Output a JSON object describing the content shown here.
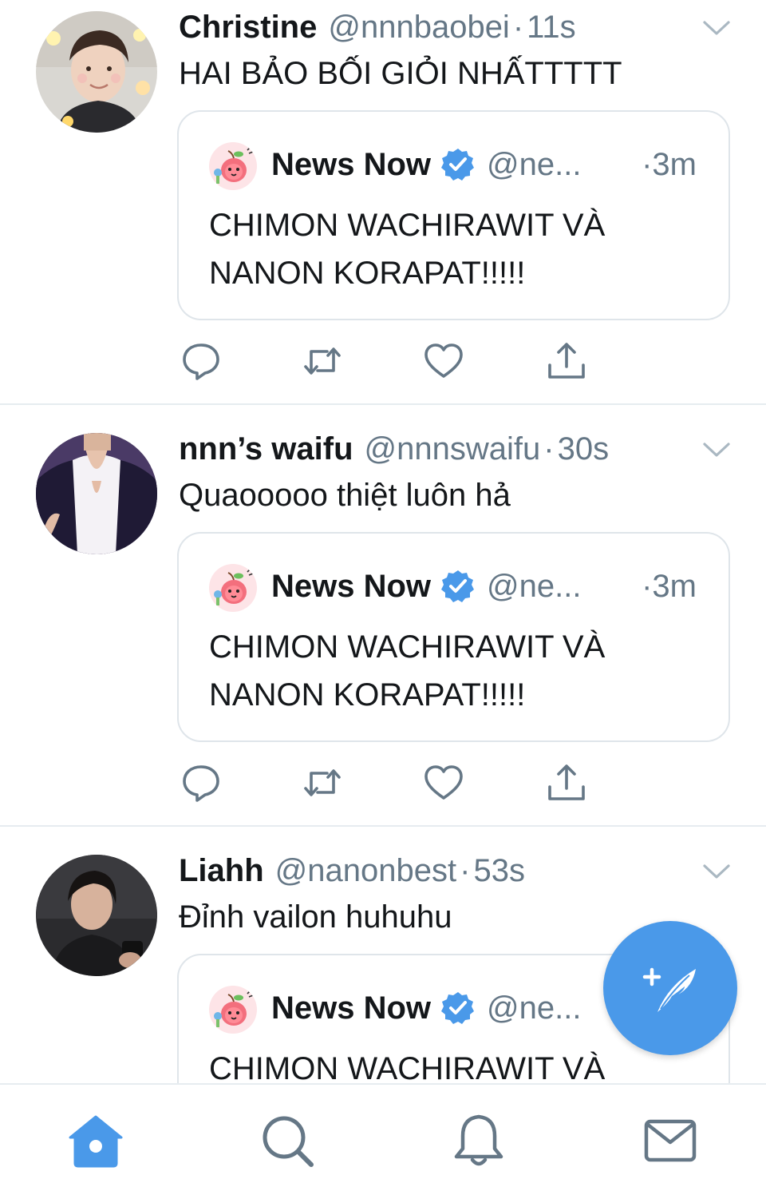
{
  "colors": {
    "accent": "#4a99e9",
    "text": "#14171a",
    "secondary": "#657786",
    "divider": "#e6ecf0",
    "icon_gray": "#657786"
  },
  "tweets": [
    {
      "name": "Christine",
      "handle": "@nnnbaobei",
      "separator": "·",
      "time": "11s",
      "text": "HAI BẢO BỐI GIỎI NHẤTTTTT",
      "quote": {
        "name": "News Now",
        "verified": true,
        "handle": "@ne...",
        "time": "·3m",
        "text": "CHIMON WACHIRAWIT VÀ NANON KORAPAT!!!!!"
      }
    },
    {
      "name": "nnn’s waifu",
      "handle": "@nnnswaifu",
      "separator": "·",
      "time": "30s",
      "text": "Quaooooo thiệt luôn hả",
      "quote": {
        "name": "News Now",
        "verified": true,
        "handle": "@ne...",
        "time": "·3m",
        "text": "CHIMON WACHIRAWIT VÀ NANON KORAPAT!!!!!"
      }
    },
    {
      "name": "Liahh",
      "handle": "@nanonbest",
      "separator": "·",
      "time": "53s",
      "text": "Đỉnh vailon huhuhu",
      "quote": {
        "name": "News Now",
        "verified": true,
        "handle": "@ne...",
        "text": "CHIMON WACHIRAWIT VÀ"
      }
    }
  ],
  "actions": [
    "reply-icon",
    "retweet-icon",
    "like-icon",
    "share-icon"
  ],
  "fab": {
    "icon": "compose-tweet-icon"
  },
  "tabbar": {
    "items": [
      "home-icon",
      "search-icon",
      "notifications-icon",
      "messages-icon"
    ],
    "active": "home-icon"
  }
}
